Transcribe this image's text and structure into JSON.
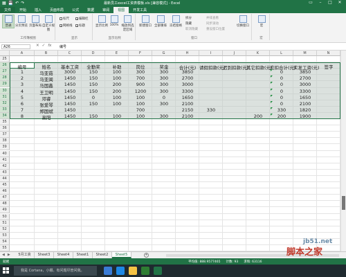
{
  "titlebar": {
    "title": "最新员工excel工资表模板.xls [兼容模式] - Excel"
  },
  "ribbon": {
    "tabs": [
      "文件",
      "开始",
      "插入",
      "页面布局",
      "公式",
      "数据",
      "审阅",
      "视图",
      "开发工具"
    ],
    "active_tab": "视图",
    "groups": [
      {
        "name": "工作簿视图",
        "buttons": [
          "普通",
          "分页预览",
          "页面布局",
          "自定义视图"
        ]
      },
      {
        "name": "显示",
        "checks": [
          "标尺",
          "网格线",
          "编辑栏",
          "标题"
        ]
      },
      {
        "name": "显示比例",
        "buttons": [
          "显示比例",
          "100%",
          "缩放到选定区域"
        ]
      },
      {
        "name": "窗口",
        "buttons": [
          "新建窗口",
          "全部重排",
          "冻结窗格"
        ],
        "small": [
          "拆分",
          "隐藏",
          "取消隐藏",
          "并排查看",
          "同步滚动",
          "重设窗口位置"
        ],
        "switch": "切换窗口"
      },
      {
        "name": "宏",
        "buttons": [
          "宏"
        ]
      }
    ]
  },
  "formula_bar": {
    "name_box": "A26",
    "value": "编号"
  },
  "columns": [
    "A",
    "B",
    "C",
    "D",
    "E",
    "F",
    "G",
    "H",
    "I",
    "J",
    "K",
    "L",
    "M",
    "N"
  ],
  "rows": [
    {
      "n": "25"
    },
    {
      "n": "26"
    },
    {
      "n": "27"
    },
    {
      "n": "28"
    },
    {
      "n": "29"
    },
    {
      "n": "30"
    },
    {
      "n": "31"
    },
    {
      "n": "32"
    },
    {
      "n": "33"
    },
    {
      "n": "34"
    },
    {
      "n": "35"
    },
    {
      "n": "36"
    },
    {
      "n": "37"
    },
    {
      "n": "38"
    },
    {
      "n": "39"
    },
    {
      "n": "40"
    },
    {
      "n": "41"
    },
    {
      "n": "42"
    },
    {
      "n": "43"
    },
    {
      "n": "44"
    },
    {
      "n": "45"
    },
    {
      "n": "46"
    },
    {
      "n": "47"
    },
    {
      "n": "48"
    },
    {
      "n": "49"
    },
    {
      "n": "50"
    },
    {
      "n": "51"
    },
    {
      "n": "52"
    },
    {
      "n": "53"
    },
    {
      "n": "54"
    },
    {
      "n": "55"
    },
    {
      "n": "56"
    },
    {
      "n": "57"
    }
  ],
  "table": {
    "headers": [
      "编号",
      "姓名",
      "基本工资",
      "全勤奖",
      "补助",
      "岗位",
      "奖金",
      "合计(元)",
      "请假扣款(元)",
      "迟到扣款(元)",
      "其它扣款(元)",
      "应扣合计(元)",
      "实发工资(元)",
      "签字"
    ],
    "rows": [
      [
        "1",
        "马亚茹",
        "3000",
        "150",
        "100",
        "300",
        "300",
        "3850",
        "",
        "",
        "",
        "0",
        "3850",
        ""
      ],
      [
        "2",
        "马亚闽",
        "1450",
        "150",
        "100",
        "700",
        "300",
        "2700",
        "",
        "",
        "",
        "0",
        "2700",
        ""
      ],
      [
        "3",
        "马国鑫",
        "1450",
        "150",
        "200",
        "900",
        "300",
        "3000",
        "",
        "",
        "",
        "0",
        "3000",
        ""
      ],
      [
        "4",
        "王卫明",
        "1450",
        "150",
        "200",
        "1200",
        "300",
        "3300",
        "",
        "",
        "",
        "0",
        "3300",
        ""
      ],
      [
        "5",
        "邓睿",
        "1450",
        "0",
        "100",
        "100",
        "0",
        "1650",
        "",
        "",
        "",
        "0",
        "1650",
        ""
      ],
      [
        "6",
        "张爱琴",
        "1450",
        "150",
        "100",
        "100",
        "300",
        "2100",
        "",
        "",
        "",
        "0",
        "2100",
        ""
      ],
      [
        "7",
        "郑国斌",
        "1450",
        "",
        "",
        "700",
        "",
        "2150",
        "330",
        "",
        "",
        "330",
        "1820",
        ""
      ],
      [
        "8",
        "高阳",
        "1450",
        "150",
        "100",
        "100",
        "300",
        "2100",
        "",
        "",
        "200",
        "200",
        "1900",
        ""
      ]
    ]
  },
  "sheets": [
    "5月工资",
    "Sheet3",
    "Sheet4",
    "Sheet1",
    "Sheet2",
    "Sheet5"
  ],
  "active_sheet": "Sheet5",
  "status": {
    "left": "就绪",
    "average": "平均值: 888.9577465",
    "count": "计数: 93",
    "sum": "求和: 63116"
  },
  "taskbar": {
    "cortana": "我是 Cortana，小娜。有问题尽管问我。"
  },
  "watermark": {
    "line1": "jb51.net",
    "line2": "脚本之家"
  },
  "colors": {
    "accent": "#217346",
    "selection": "#bec8c3",
    "taskbar": "#1f2a2f"
  }
}
